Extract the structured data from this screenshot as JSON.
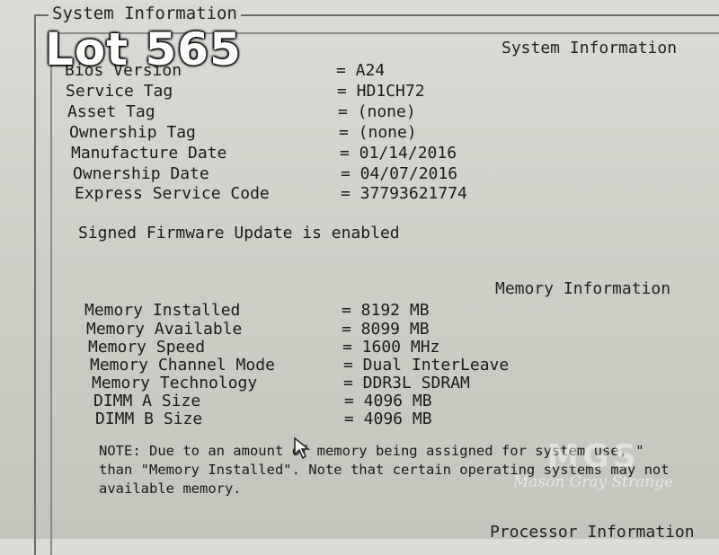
{
  "overlay": {
    "lot_label": "Lot 565"
  },
  "frame": {
    "title": "System Information"
  },
  "system": {
    "heading": "System Information",
    "rows": [
      {
        "label": "Bios Version",
        "value": "= A24"
      },
      {
        "label": "Service Tag",
        "value": "= HD1CH72"
      },
      {
        "label": "Asset Tag",
        "value": "= (none)"
      },
      {
        "label": "Ownership Tag",
        "value": "= (none)"
      },
      {
        "label": "Manufacture Date",
        "value": "= 01/14/2016"
      },
      {
        "label": "Ownership Date",
        "value": "= 04/07/2016"
      },
      {
        "label": "Express Service Code",
        "value": "= 37793621774"
      }
    ],
    "firmware_status": "Signed Firmware Update is enabled"
  },
  "memory": {
    "heading": "Memory Information",
    "rows": [
      {
        "label": "Memory Installed",
        "value": "= 8192 MB"
      },
      {
        "label": "Memory Available",
        "value": "= 8099 MB"
      },
      {
        "label": "Memory Speed",
        "value": "= 1600 MHz"
      },
      {
        "label": "Memory Channel Mode",
        "value": "= Dual InterLeave"
      },
      {
        "label": "Memory Technology",
        "value": "= DDR3L SDRAM"
      },
      {
        "label": "DIMM A Size",
        "value": "= 4096 MB"
      },
      {
        "label": "DIMM B Size",
        "value": "= 4096 MB"
      }
    ],
    "note_lines": [
      "NOTE: Due to an amount of memory being assigned for system use, \"",
      "than \"Memory Installed\". Note that certain operating systems may not",
      "available memory."
    ]
  },
  "processor": {
    "heading": "Processor Information"
  },
  "watermark": {
    "logo": "MGS",
    "text": "Mason Gray Strange"
  }
}
